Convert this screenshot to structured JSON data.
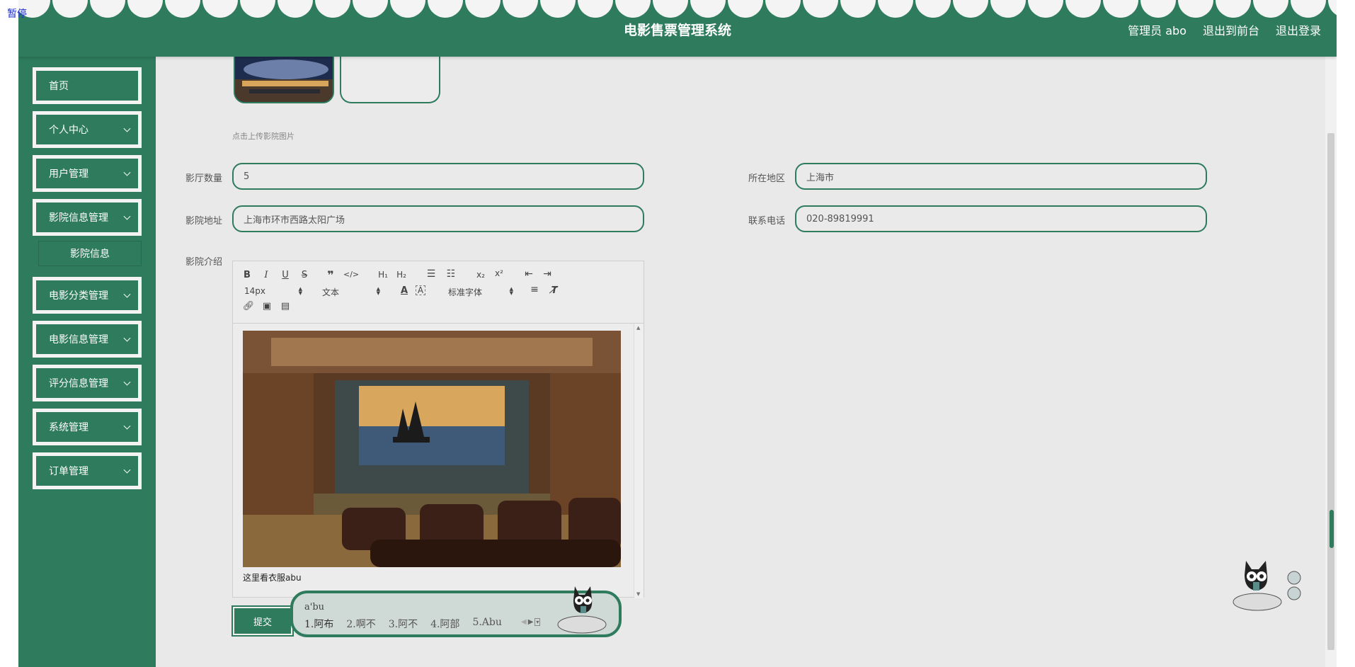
{
  "overlay": {
    "pause": "暂停"
  },
  "header": {
    "title": "电影售票管理系统",
    "admin": "管理员 abo",
    "to_front": "退出到前台",
    "logout": "退出登录"
  },
  "sidebar": {
    "items": [
      {
        "label": "首页"
      },
      {
        "label": "个人中心"
      },
      {
        "label": "用户管理"
      },
      {
        "label": "影院信息管理"
      },
      {
        "label": "电影分类管理"
      },
      {
        "label": "电影信息管理"
      },
      {
        "label": "评分信息管理"
      },
      {
        "label": "系统管理"
      },
      {
        "label": "订单管理"
      }
    ],
    "sub_item": "影院信息"
  },
  "form": {
    "upload_hint": "点击上传影院图片",
    "hall_count_label": "影厅数量",
    "hall_count_value": "5",
    "region_label": "所在地区",
    "region_value": "上海市",
    "address_label": "影院地址",
    "address_value": "上海市环市西路太阳广场",
    "phone_label": "联系电话",
    "phone_value": "020-89819991",
    "intro_label": "影院介绍"
  },
  "editor": {
    "font_size": "14px",
    "block_type": "文本",
    "font_family": "标准字体",
    "content_text": "这里看衣服abu"
  },
  "submit": "提交",
  "ime": {
    "composition": "a'bu",
    "candidates": [
      "1.阿布",
      "2.啊不",
      "3.阿不",
      "4.阿部",
      "5.Abu"
    ]
  },
  "colors": {
    "primary": "#2e7b5e",
    "background": "#e9e9e9"
  }
}
